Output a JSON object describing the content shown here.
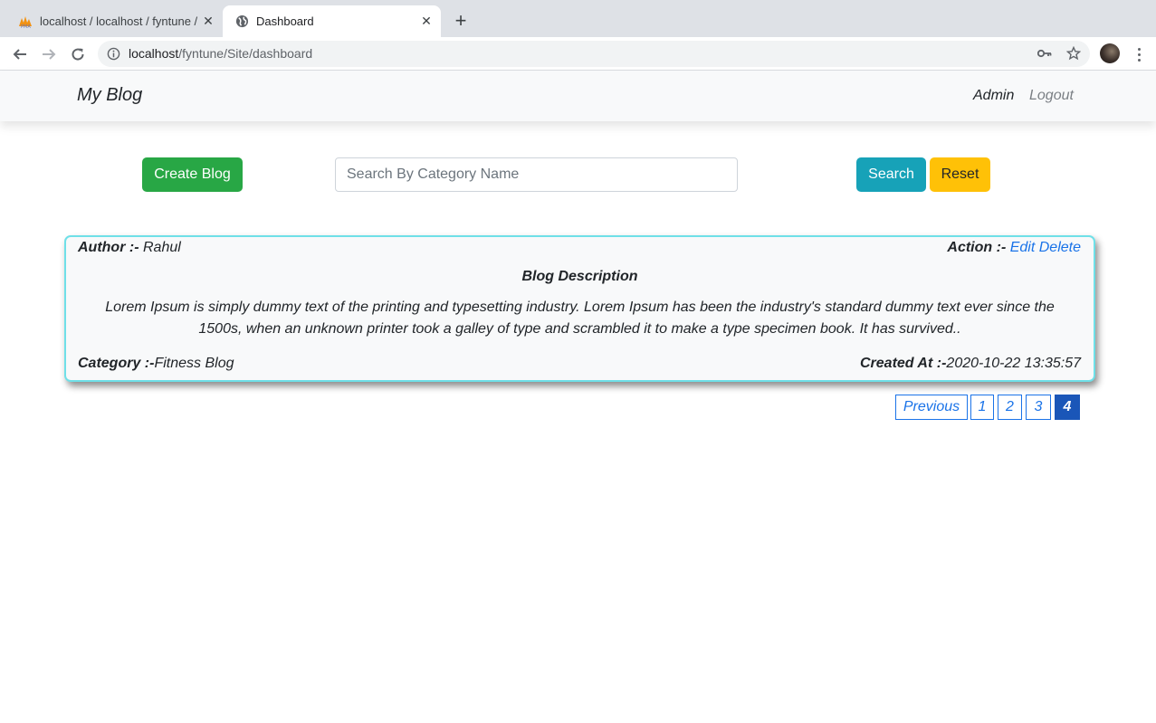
{
  "browser": {
    "tabs": [
      {
        "title": "localhost / localhost / fyntune / …",
        "favicon": "pma-icon",
        "active": false
      },
      {
        "title": "Dashboard",
        "favicon": "globe-icon",
        "active": true
      }
    ],
    "url_host": "localhost",
    "url_path": "/fyntune/Site/dashboard"
  },
  "nav": {
    "brand": "My Blog",
    "admin": "Admin",
    "logout": "Logout"
  },
  "controls": {
    "create_label": "Create Blog",
    "search_placeholder": "Search By Category Name",
    "search_value": "",
    "search_label": "Search",
    "reset_label": "Reset"
  },
  "blog": {
    "author_label": "Author :-",
    "author": "Rahul",
    "action_label": "Action :-",
    "edit_label": "Edit",
    "delete_label": "Delete",
    "desc_title": "Blog Description",
    "description": "Lorem Ipsum is simply dummy text of the printing and typesetting industry. Lorem Ipsum has been the industry's standard dummy text ever since the 1500s, when an unknown printer took a galley of type and scrambled it to make a type specimen book. It has survived..",
    "category_label": "Category :-",
    "category": "Fitness Blog",
    "created_label": "Created At :-",
    "created_at": "2020-10-22 13:35:57"
  },
  "pagination": {
    "previous": "Previous",
    "pages": [
      "1",
      "2",
      "3",
      "4"
    ],
    "current": "4"
  },
  "colors": {
    "create": "#28a745",
    "search": "#17a2b8",
    "reset": "#ffc107",
    "link": "#1a73e8",
    "card_border": "#6fe0e8",
    "active_page": "#1a56b8"
  }
}
